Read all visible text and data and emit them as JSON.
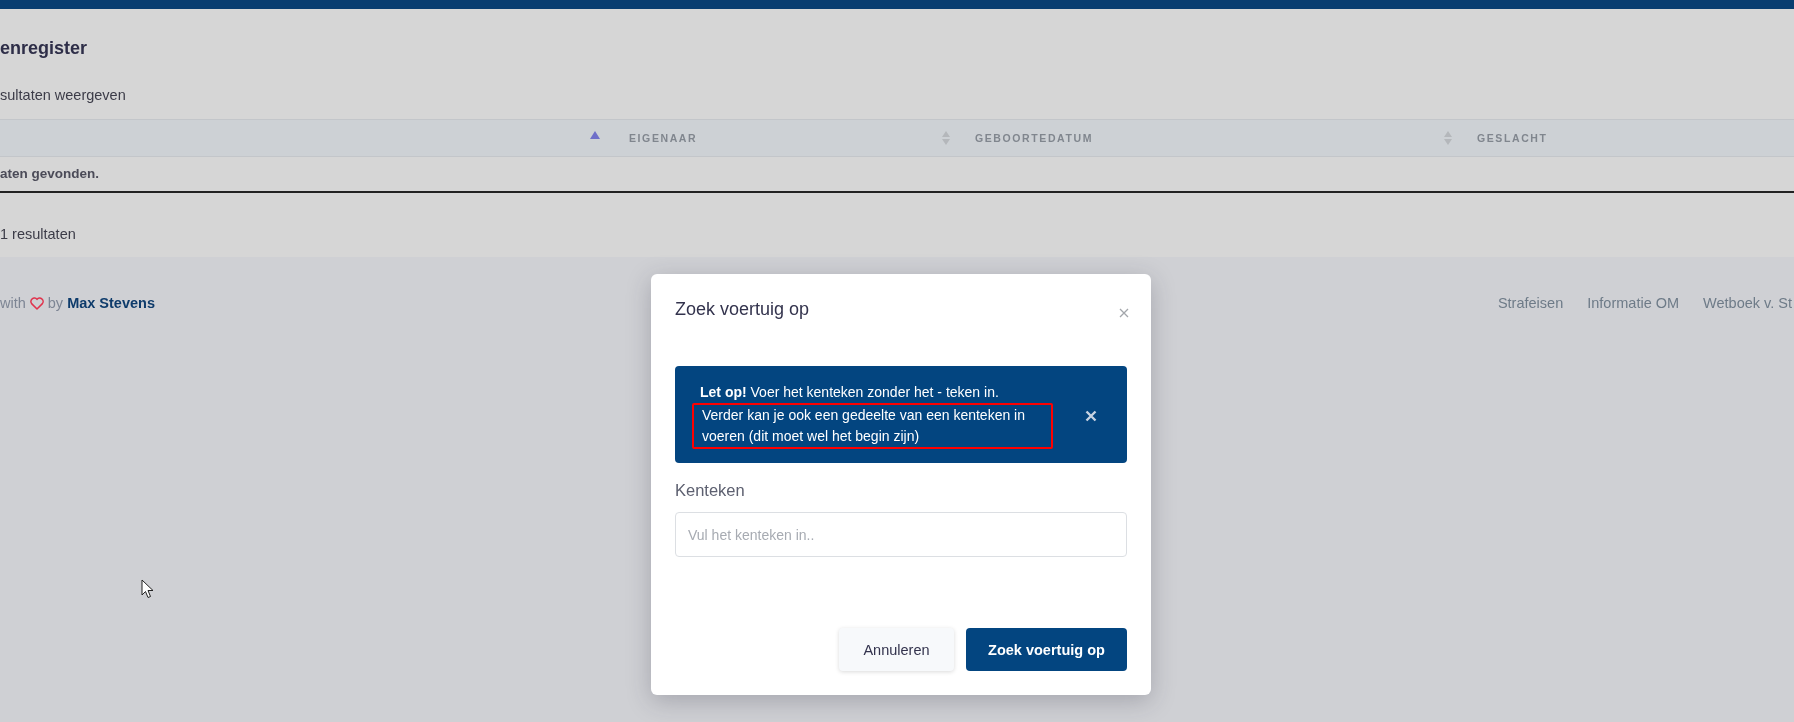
{
  "page": {
    "title": "enregister",
    "results_info": "sultaten weergeven",
    "table": {
      "columns": [
        {
          "sortable": true,
          "sorted_ascending": true
        },
        {
          "label": "EIGENAAR",
          "sortable": true,
          "sorted_ascending": false
        },
        {
          "label": "GEBOORTEDATUM",
          "sortable": true,
          "sorted_ascending": false
        },
        {
          "label": "GESLACHT",
          "sortable": false,
          "sorted_ascending": false
        }
      ],
      "empty_message": "aten gevonden."
    },
    "results_count": "1 resultaten"
  },
  "footer": {
    "made_with": "with",
    "by": "by",
    "author": "Max Stevens",
    "links": [
      "Strafeisen",
      "Informatie OM",
      "Wetboek v. St"
    ]
  },
  "modal": {
    "title": "Zoek voertuig op",
    "alert": {
      "first_line": "**Let op!** Voer het kenteken zonder het - teken in.",
      "second_line": "Verder kan je ook een gedeelte van een kenteken in voeren (dit moet wel het begin zijn)",
      "highlighted": true
    },
    "field": {
      "label": "Kenteken",
      "placeholder": "Vul het kenteken in.."
    },
    "buttons": [
      {
        "label": "Annuleren",
        "kind": "secondary"
      },
      {
        "label": "Zoek voertuig op",
        "kind": "primary"
      }
    ]
  }
}
